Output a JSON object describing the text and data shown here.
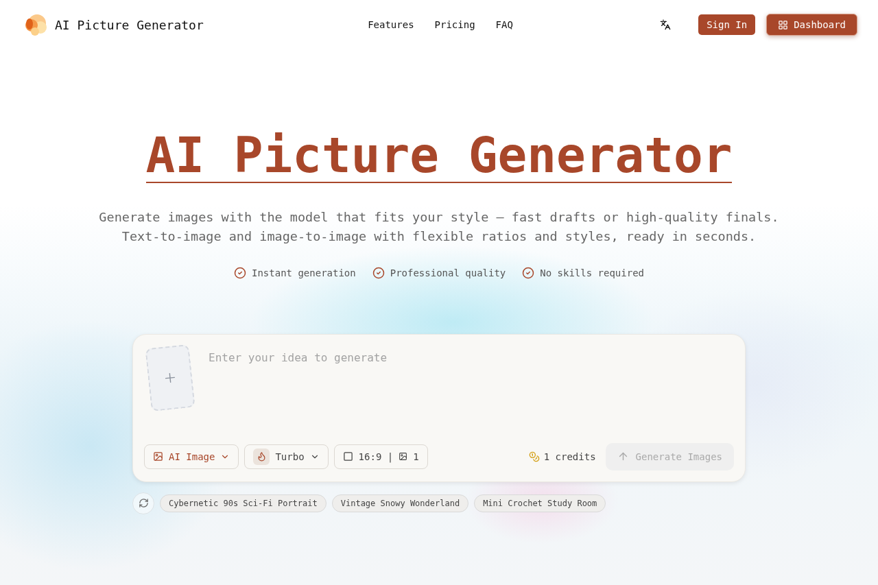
{
  "brand": {
    "name": "AI Picture Generator"
  },
  "nav": [
    {
      "label": "Features"
    },
    {
      "label": "Pricing"
    },
    {
      "label": "FAQ"
    }
  ],
  "header_actions": {
    "sign_in": "Sign In",
    "dashboard": "Dashboard"
  },
  "hero": {
    "title": "AI Picture Generator",
    "subtitle_lines": [
      "Generate images with the model that fits your style — fast drafts or high-quality finals.",
      "Text-to-image and image-to-image with flexible ratios and styles, ready in seconds."
    ],
    "features": [
      {
        "label": "Instant generation"
      },
      {
        "label": "Professional quality"
      },
      {
        "label": "No skills required"
      }
    ]
  },
  "composer": {
    "placeholder": "Enter your idea to generate",
    "mode": "AI Image",
    "model": "Turbo",
    "ratio": "16:9",
    "separator": "|",
    "count": "1",
    "credits": "1 credits",
    "generate": {
      "label": "Generate Images",
      "disabled": true
    }
  },
  "suggestions": [
    {
      "label": "Cybernetic 90s Sci-Fi Portrait"
    },
    {
      "label": "Vintage Snowy Wonderland"
    },
    {
      "label": "Mini Crochet Study Room"
    }
  ]
}
